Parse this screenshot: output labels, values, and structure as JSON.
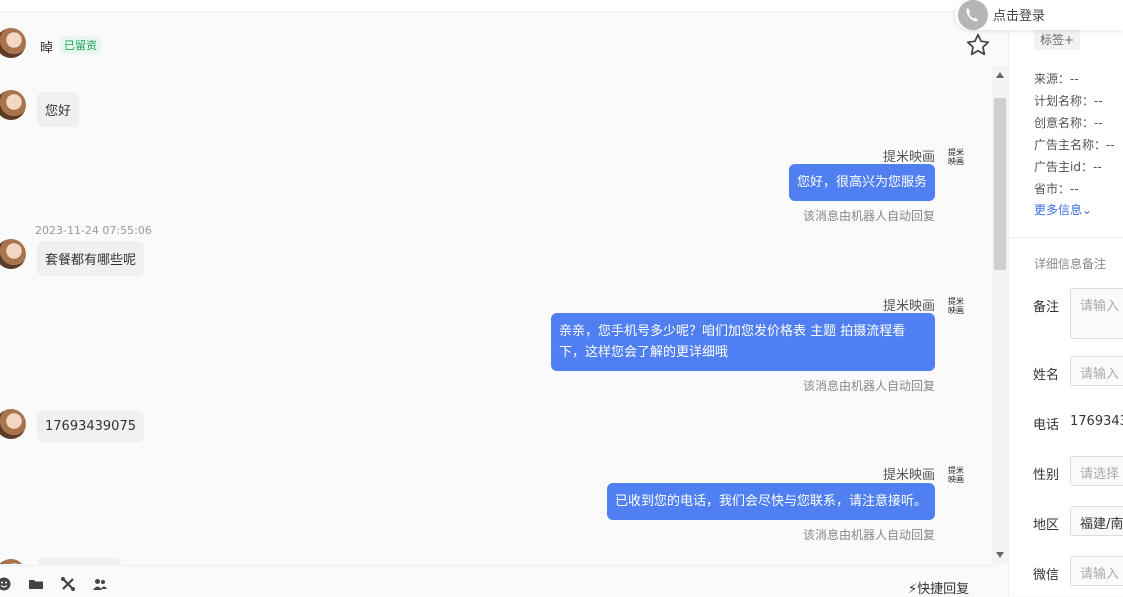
{
  "header": {
    "contact_name": "晫",
    "status_badge": "已留资"
  },
  "messages": {
    "m1": {
      "text": "您好"
    },
    "m2": {
      "sender": "提米映画",
      "text": "您好，很高兴为您服务",
      "note": "该消息由机器人自动回复"
    },
    "m3": {
      "timestamp": "2023-11-24 07:55:06",
      "text": "套餐都有哪些呢"
    },
    "m4": {
      "sender": "提米映画",
      "text": "亲亲，您手机号多少呢？咱们加您发价格表 主题 拍摄流程看下，这样您会了解的更详细哦",
      "note": "该消息由机器人自动回复"
    },
    "m5": {
      "text": "17693439075"
    },
    "m6": {
      "sender": "提米映画",
      "text": "已收到您的电话，我们会尽快与您联系，请注意接听。",
      "note": "该消息由机器人自动回复"
    },
    "brand_logo": "提米映画"
  },
  "toolbar": {
    "quick_reply": "快捷回复"
  },
  "login": {
    "label": "点击登录"
  },
  "panel": {
    "tag_button": "标签+",
    "info": [
      {
        "label": "来源：",
        "value": "--"
      },
      {
        "label": "计划名称：",
        "value": "--"
      },
      {
        "label": "创意名称：",
        "value": "--"
      },
      {
        "label": "广告主名称：",
        "value": "--"
      },
      {
        "label": "广告主id：",
        "value": "--"
      },
      {
        "label": "省市：",
        "value": "--"
      }
    ],
    "more_info": "更多信息⌄",
    "section_title": "详细信息备注",
    "fields": {
      "note": {
        "label": "备注",
        "placeholder": "请输入"
      },
      "name": {
        "label": "姓名",
        "placeholder": "请输入"
      },
      "phone": {
        "label": "电话",
        "value": "1769343"
      },
      "gender": {
        "label": "性别",
        "placeholder": "请选择"
      },
      "region": {
        "label": "地区",
        "value": "福建/南"
      },
      "wechat": {
        "label": "微信",
        "placeholder": "请输入"
      }
    }
  },
  "colors": {
    "accent": "#4f7ff0",
    "badge_green": "#1aa35a"
  }
}
